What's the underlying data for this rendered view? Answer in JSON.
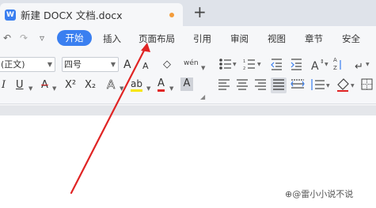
{
  "window": {
    "tab_icon": "wps-writer-icon",
    "tab_icon_letter": "W",
    "doc_title": "新建 DOCX 文档.docx",
    "new_tab_symbol": "+"
  },
  "menubar": {
    "undo_icon": "↶",
    "redo_icon": "↷",
    "more_icon": "▿",
    "items": [
      "开始",
      "插入",
      "页面布局",
      "引用",
      "审阅",
      "视图",
      "章节",
      "安全"
    ]
  },
  "ribbon": {
    "font_name": "(正文)",
    "font_size": "四号",
    "row2": {
      "italic": "I",
      "underline": "U",
      "strikethrough": "A",
      "superscript": "X²",
      "subscript": "X₂",
      "text_effect": "A",
      "highlight": "ab",
      "font_color": "A",
      "char_shading": "A"
    },
    "row1_extra": {
      "grow": "A",
      "shrink": "A",
      "clear": "◇",
      "pinyin": "wén"
    }
  },
  "watermark": "⊕@雷小小说不说",
  "annotation": {
    "arrow_color": "#e02424"
  },
  "colors": {
    "accent": "#3a7ff0",
    "highlight": "#f7e600",
    "font_red": "#e02424"
  }
}
